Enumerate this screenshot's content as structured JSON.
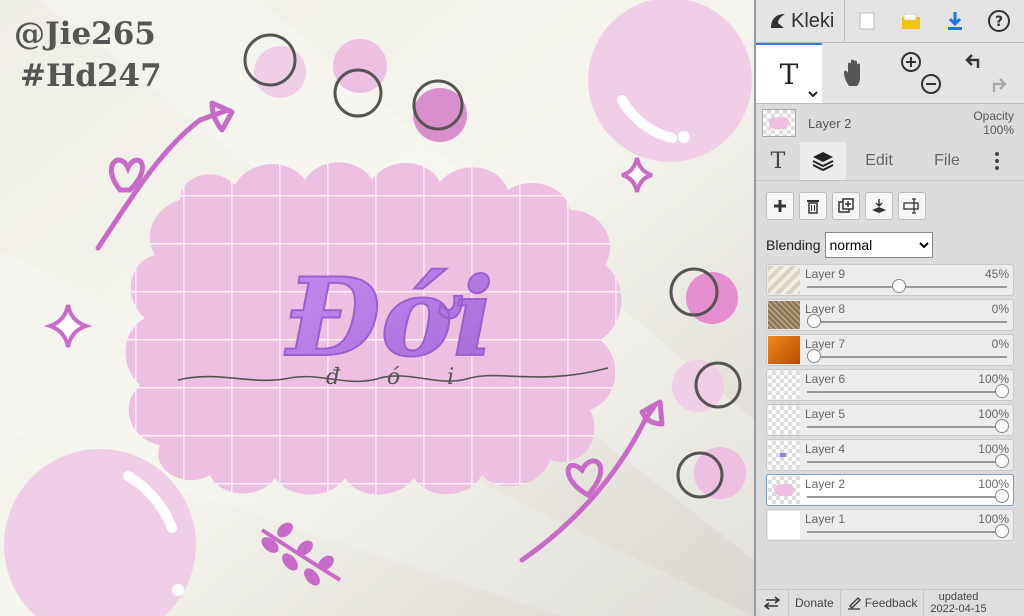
{
  "watermark": {
    "line1": "@Jie265",
    "line2": "#Hd247"
  },
  "artwork": {
    "title_text": "Đới",
    "subtitle_text": "đ ó i"
  },
  "app": {
    "name": "Kleki"
  },
  "toolbar": {
    "icons": [
      "kleki-logo-icon",
      "new-image-icon",
      "save-folder-icon",
      "download-icon",
      "help-icon"
    ]
  },
  "tools": {
    "active_glyph": "T",
    "hand": "hand-icon",
    "zoom_in": "zoom-in-icon",
    "zoom_out": "zoom-out-icon",
    "undo": "undo-icon",
    "redo": "redo-icon"
  },
  "current_layer": {
    "name": "Layer 2",
    "opacity_label": "Opacity",
    "opacity_value": "100%"
  },
  "tabs": {
    "text_glyph": "T",
    "edit": "Edit",
    "file": "File"
  },
  "layer_buttons": [
    "add-layer-icon",
    "delete-layer-icon",
    "duplicate-layer-icon",
    "merge-down-icon",
    "rename-layer-icon"
  ],
  "blending": {
    "label": "Blending",
    "value": "normal"
  },
  "layers": [
    {
      "name": "Layer 9",
      "opacity": "45%",
      "level": 0.45,
      "thumb": "stripes",
      "selected": false
    },
    {
      "name": "Layer 8",
      "opacity": "0%",
      "level": 0,
      "thumb": "fabric",
      "selected": false
    },
    {
      "name": "Layer 7",
      "opacity": "0%",
      "level": 0,
      "thumb": "orange",
      "selected": false
    },
    {
      "name": "Layer 6",
      "opacity": "100%",
      "level": 1,
      "thumb": "checker",
      "selected": false
    },
    {
      "name": "Layer 5",
      "opacity": "100%",
      "level": 1,
      "thumb": "checker",
      "selected": false
    },
    {
      "name": "Layer 4",
      "opacity": "100%",
      "level": 1,
      "thumb": "checker-dot",
      "selected": false
    },
    {
      "name": "Layer 2",
      "opacity": "100%",
      "level": 1,
      "thumb": "pink",
      "selected": true
    },
    {
      "name": "Layer 1",
      "opacity": "100%",
      "level": 1,
      "thumb": "white",
      "selected": false
    }
  ],
  "footer": {
    "donate": "Donate",
    "feedback": "Feedback",
    "updated_label": "updated",
    "updated_date": "2022-04-15"
  },
  "colors": {
    "pink_light": "#f0cfe6",
    "pink_mid": "#e9a5d9",
    "purple_accent": "#b57be8",
    "magenta_line": "#c86ac8",
    "accent_blue": "#3b7ddd"
  }
}
